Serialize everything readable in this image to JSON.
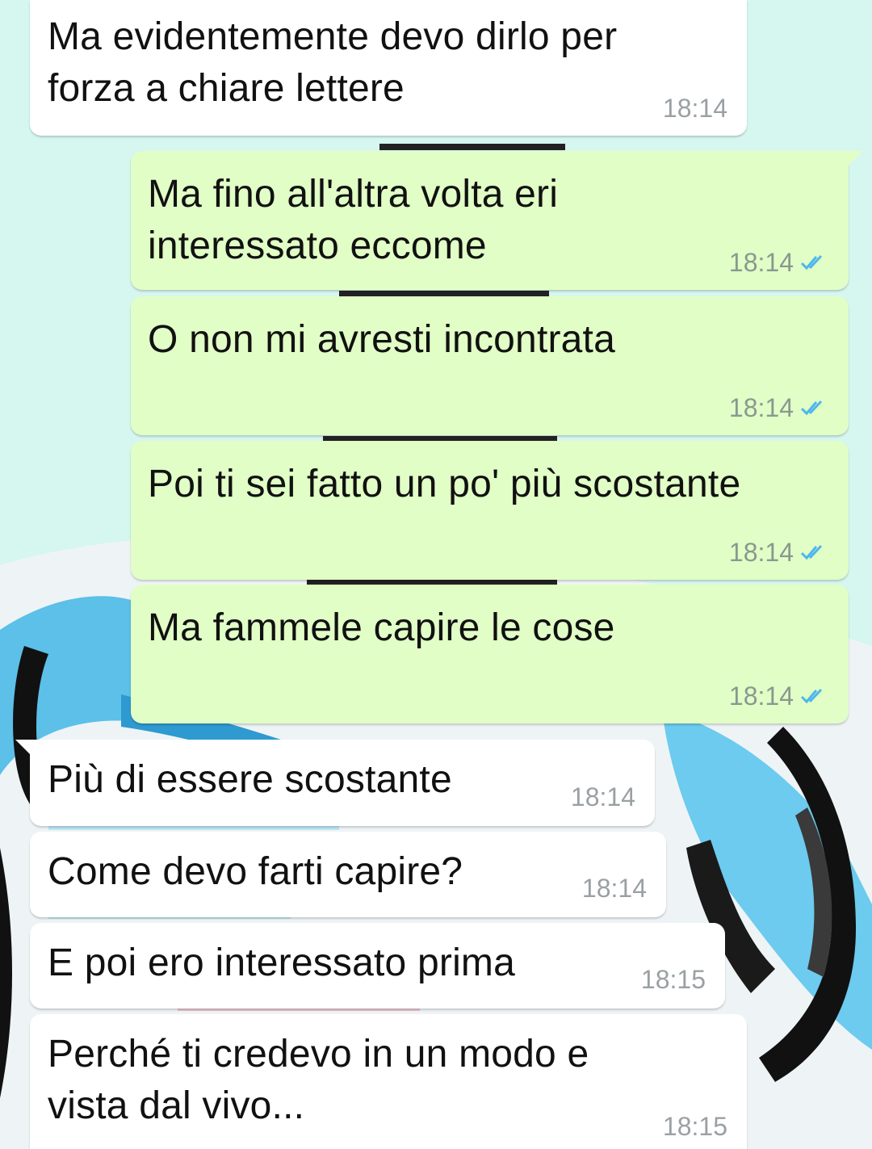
{
  "messages": [
    {
      "direction": "in",
      "text": "Ma evidentemente devo dirlo per\nforza a chiare lettere",
      "time": "18:14"
    },
    {
      "direction": "out",
      "text": "Ma fino all'altra volta eri\ninteressato eccome",
      "time": "18:14",
      "status": "read"
    },
    {
      "direction": "out",
      "text": "O non mi avresti incontrata",
      "time": "18:14",
      "status": "read"
    },
    {
      "direction": "out",
      "text": "Poi ti sei fatto un po' più scostante",
      "time": "18:14",
      "status": "read"
    },
    {
      "direction": "out",
      "text": "Ma fammele capire le cose",
      "time": "18:14",
      "status": "read"
    },
    {
      "direction": "in",
      "text": "Più di essere scostante",
      "time": "18:14"
    },
    {
      "direction": "in",
      "text": "Come devo farti capire?",
      "time": "18:14"
    },
    {
      "direction": "in",
      "text": "E poi ero interessato prima",
      "time": "18:15"
    },
    {
      "direction": "in",
      "text": "Perché ti credevo in un modo e\nvista dal vivo...",
      "time": "18:15"
    }
  ],
  "colors": {
    "incoming_bubble": "#ffffff",
    "outgoing_bubble": "#e1fec6",
    "timestamp": "#8a9890",
    "read_ticks": "#4fb6ec"
  },
  "icons": {
    "read_status": "double-check-icon"
  }
}
